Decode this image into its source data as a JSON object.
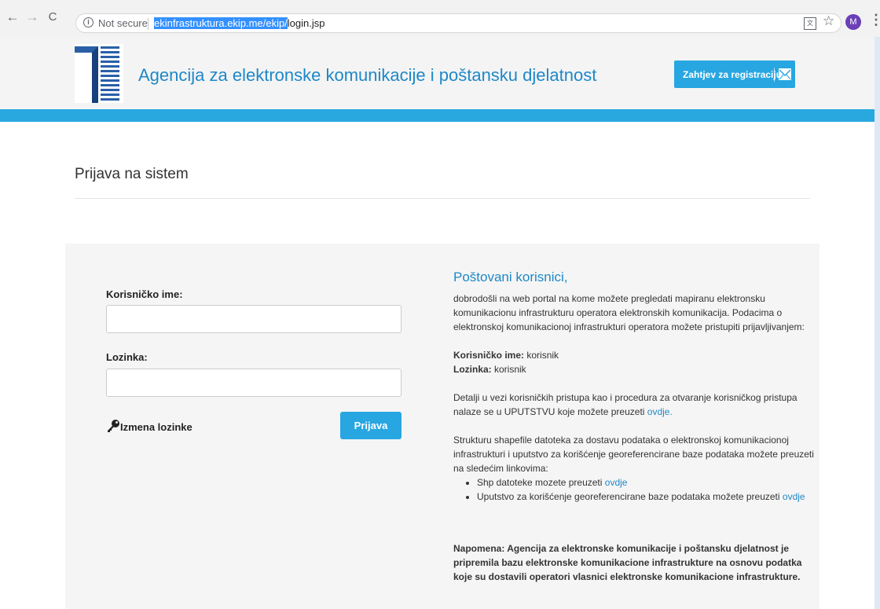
{
  "browser": {
    "not_secure": "Not secure",
    "url_selected": "ekinfrastruktura.ekip.me/ekip/",
    "url_rest": "login.jsp",
    "avatar_letter": "M"
  },
  "header": {
    "agency_name": "Agencija za elektronske komunikacije i poštansku djelatnost",
    "register_button": "Zahtjev za registraciju"
  },
  "page": {
    "title": "Prijava na sistem"
  },
  "login": {
    "username_label": "Korisničko ime:",
    "username_value": "",
    "password_label": "Lozinka:",
    "password_value": "",
    "change_password_link": "Izmena lozinke",
    "submit_button": "Prijava"
  },
  "info": {
    "greeting": "Poštovani korisnici,",
    "intro": "dobrodošli na web portal na kome možete pregledati mapiranu elektronsku komunikacionu infrastrukturu operatora elektronskih komunikacija. Podacima o elektronskoj komunikacionoj infrastrukturi operatora možete pristupiti prijavljivanjem:",
    "cred_user_label": "Korisničko ime:",
    "cred_user_value": " korisnik",
    "cred_pass_label": "Lozinka:",
    "cred_pass_value": " korisnik",
    "details_text": "Detalji u vezi korisničkih pristupa kao i procedura za otvaranje korisničkog pristupa nalaze se u UPUTSTVU koje možete preuzeti ",
    "details_link": "ovdje.",
    "structure_text": "Strukturu shapefile datoteka za dostavu podataka o elektronskoj komunikacionoj infrastrukturi i uputstvo za korišćenje georeferencirane baze podataka možete preuzeti na sledećim linkovima:",
    "list": [
      {
        "text": "Shp datoteke mozete preuzeti ",
        "link": "ovdje"
      },
      {
        "text": "Uputstvo za korišćenje georeferencirane baze podataka možete preuzeti ",
        "link": "ovdje"
      }
    ],
    "note": "Napomena: Agencija za elektronske komunikacije i poštansku djelatnost je pripremila bazu elektronske komunikacione infrastrukture na osnovu podatka koje su dostavili operatori vlasnici elektronske komunikacione infrastrukture."
  },
  "colors": {
    "accent": "#27a6e1",
    "title_blue": "#1e88c7"
  }
}
